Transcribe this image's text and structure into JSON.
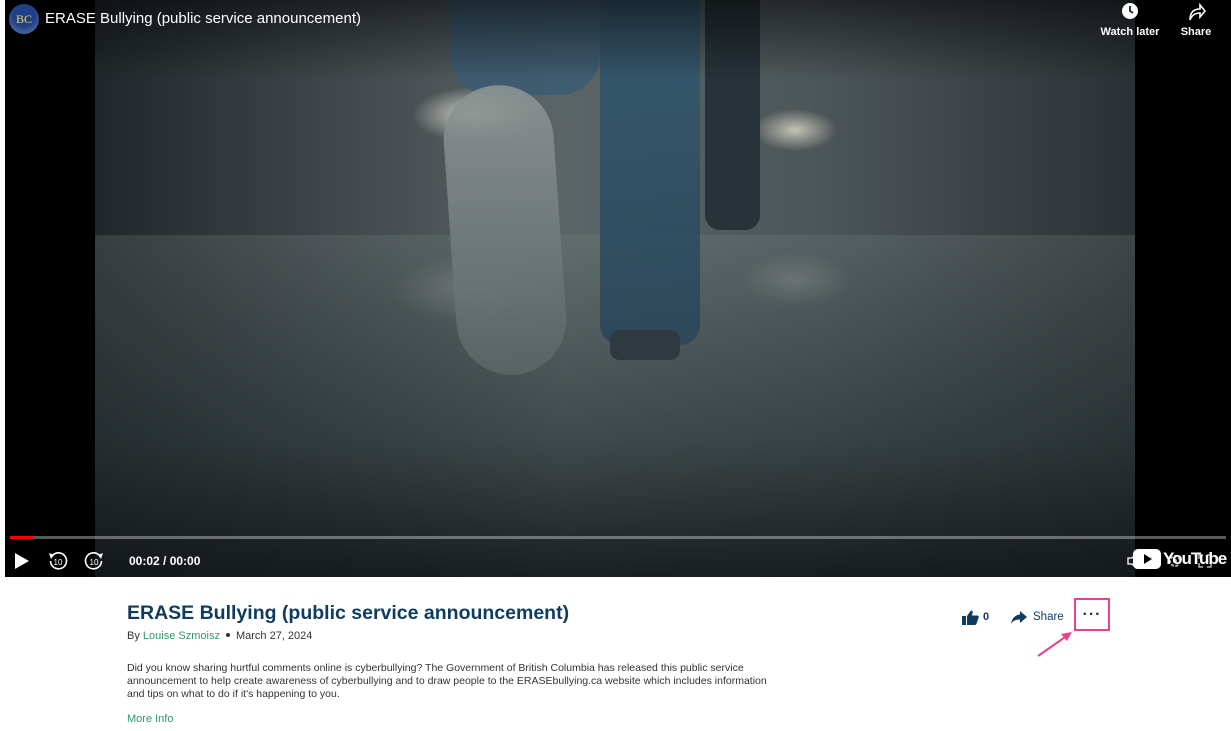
{
  "player": {
    "channel_logo_text": "BC",
    "title": "ERASE Bullying (public service announcement)",
    "watch_later_label": "Watch later",
    "share_label": "Share",
    "time_display": "00:02 / 00:00",
    "rewind_seconds": "10",
    "forward_seconds": "10",
    "brand": "YouTube",
    "progress": 0.002
  },
  "video_info": {
    "title": "ERASE Bullying (public service announcement)",
    "by_prefix": "By",
    "author": "Louise Szmoisz",
    "date": "March 27, 2024",
    "description": "Did you know sharing hurtful comments online is cyberbullying? The Government of British Columbia has released this public service announcement to help create awareness of cyberbullying and to draw people to the ERASEbullying.ca website which includes information and tips on what to do if it's happening to you.",
    "more_info_label": "More Info"
  },
  "actions": {
    "like_count": "0",
    "share_label": "Share",
    "more_label": "···"
  },
  "colors": {
    "accent": "#2f9a6e",
    "title_blue": "#0e3b5e",
    "highlight_pink": "#e8428c"
  },
  "icons": [
    "clock-icon",
    "share-arrow-icon",
    "play-icon",
    "rewind-10-icon",
    "forward-10-icon",
    "mute-icon",
    "settings-icon",
    "fullscreen-icon",
    "thumbs-up-icon",
    "share-icon",
    "more-icon"
  ]
}
